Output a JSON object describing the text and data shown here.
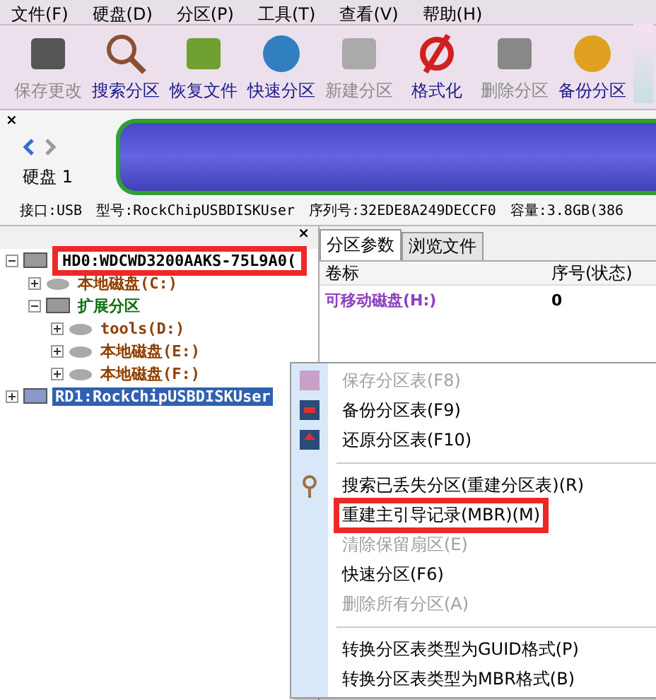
{
  "menu_bar": [
    "文件(F)",
    "硬盘(D)",
    "分区(P)",
    "工具(T)",
    "查看(V)",
    "帮助(H)"
  ],
  "toolbar": [
    {
      "label": "保存更改",
      "disabled": true,
      "kind": "save"
    },
    {
      "label": "搜索分区",
      "disabled": false,
      "kind": "search"
    },
    {
      "label": "恢复文件",
      "disabled": false,
      "kind": "recover"
    },
    {
      "label": "快速分区",
      "disabled": false,
      "kind": "quick"
    },
    {
      "label": "新建分区",
      "disabled": true,
      "kind": "new"
    },
    {
      "label": "格式化",
      "disabled": false,
      "kind": "format"
    },
    {
      "label": "删除分区",
      "disabled": true,
      "kind": "delete"
    },
    {
      "label": "备份分区",
      "disabled": false,
      "kind": "backup"
    }
  ],
  "disk_panel": {
    "close": "×",
    "disk_label": "硬盘 1",
    "info": [
      "接口:USB",
      "型号:RockChipUSBDISKUser",
      "序列号:32EDE8A249DECCF0",
      "容量:3.8GB(386"
    ]
  },
  "tree": {
    "close": "×",
    "items": [
      {
        "label": "HD0:WDCWD3200AAKS-75L9A0(",
        "kind": "disk",
        "selected": false,
        "highlighted": true,
        "expanded": true,
        "children": [
          {
            "label": "本地磁盘(C:)",
            "kind": "partition",
            "selected": false,
            "highlighted": false,
            "expanded": false
          },
          {
            "label": "扩展分区",
            "kind": "extended",
            "selected": false,
            "highlighted": false,
            "expanded": true,
            "children": [
              {
                "label": "tools(D:)",
                "kind": "partition",
                "selected": false,
                "highlighted": false,
                "expanded": false
              },
              {
                "label": "本地磁盘(E:)",
                "kind": "partition",
                "selected": false,
                "highlighted": false,
                "expanded": false
              },
              {
                "label": "本地磁盘(F:)",
                "kind": "partition",
                "selected": false,
                "highlighted": false,
                "expanded": false
              }
            ]
          }
        ]
      },
      {
        "label": "RD1:RockChipUSBDISKUser",
        "kind": "removable",
        "selected": true,
        "highlighted": false,
        "expanded": false
      }
    ]
  },
  "tabs": [
    {
      "label": "分区参数",
      "selected": true
    },
    {
      "label": "浏览文件",
      "selected": false
    }
  ],
  "table": {
    "columns": [
      "卷标",
      "序号(状态)"
    ],
    "rows": [
      [
        "可移动磁盘(H:)",
        "0"
      ]
    ]
  },
  "context_menu": [
    {
      "kind": "item",
      "label": "保存分区表(F8)",
      "disabled": true,
      "highlighted": false
    },
    {
      "kind": "item",
      "label": "备份分区表(F9)",
      "disabled": false,
      "highlighted": false
    },
    {
      "kind": "item",
      "label": "还原分区表(F10)",
      "disabled": false,
      "highlighted": false
    },
    {
      "kind": "separator"
    },
    {
      "kind": "item",
      "label": "搜索已丢失分区(重建分区表)(R)",
      "disabled": false,
      "highlighted": false
    },
    {
      "kind": "item",
      "label": "重建主引导记录(MBR)(M)",
      "disabled": false,
      "highlighted": true
    },
    {
      "kind": "item",
      "label": "清除保留扇区(E)",
      "disabled": true,
      "highlighted": false
    },
    {
      "kind": "item",
      "label": "快速分区(F6)",
      "disabled": false,
      "highlighted": false
    },
    {
      "kind": "item",
      "label": "删除所有分区(A)",
      "disabled": true,
      "highlighted": false
    },
    {
      "kind": "separator"
    },
    {
      "kind": "item",
      "label": "转换分区表类型为GUID格式(P)",
      "disabled": false,
      "highlighted": false
    },
    {
      "kind": "item",
      "label": "转换分区表类型为MBR格式(B)",
      "disabled": false,
      "highlighted": false
    }
  ]
}
